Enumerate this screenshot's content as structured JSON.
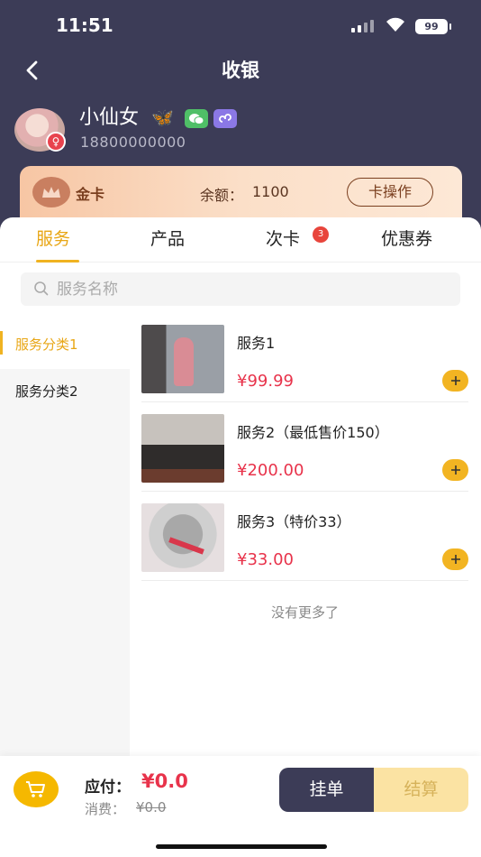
{
  "status": {
    "time": "11:51",
    "battery": "99"
  },
  "header": {
    "title": "收银"
  },
  "member": {
    "name": "小仙女",
    "phone": "18800000000",
    "card_type": "金卡",
    "balance_label": "余额：",
    "balance_value": "1100",
    "card_op_label": "卡操作"
  },
  "tabs": [
    {
      "label": "服务",
      "active": true
    },
    {
      "label": "产品",
      "active": false
    },
    {
      "label": "次卡",
      "active": false,
      "badge": "3"
    },
    {
      "label": "优惠券",
      "active": false
    }
  ],
  "search": {
    "placeholder": "服务名称"
  },
  "categories": [
    {
      "label": "服务分类1",
      "active": true
    },
    {
      "label": "服务分类2",
      "active": false
    }
  ],
  "products": [
    {
      "name": "服务1",
      "price": "¥99.99"
    },
    {
      "name": "服务2（最低售价150）",
      "price": "¥200.00"
    },
    {
      "name": "服务3（特价33）",
      "price": "¥33.00"
    }
  ],
  "list_end_text": "没有更多了",
  "footer": {
    "pay_label": "应付：",
    "pay_value": "¥0.0",
    "consume_label": "消费：",
    "consume_value": "¥0.0",
    "hold_label": "挂单",
    "settle_label": "结算"
  },
  "colors": {
    "header_bg": "#3c3c57",
    "accent": "#f0b321",
    "price": "#e8334b"
  }
}
